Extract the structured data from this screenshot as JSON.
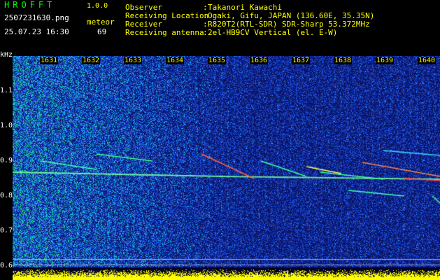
{
  "app": {
    "name": "HROFFT",
    "version": "1.0.0"
  },
  "capture": {
    "filename": "2507231630.png",
    "datetime": "25.07.23 16:30",
    "meteor_label": "meteor",
    "meteor_count": "69"
  },
  "info": [
    {
      "label": "Observer",
      "value": "Takanori Kawachi"
    },
    {
      "label": "Receiving Location",
      "value": "Ogaki, Gifu, JAPAN (136.60E, 35.35N)"
    },
    {
      "label": "Receiver",
      "value": "R820T2(RTL-SDR) SDR-Sharp 53.372MHz"
    },
    {
      "label": "Receiving antenna",
      "value": "2el-HB9CV Vertical (el. E-W)"
    }
  ],
  "spectrogram": {
    "y_unit": "kHz",
    "y_ticks": [
      "1.1",
      "1.0",
      "0.9",
      "0.8",
      "0.7",
      "0.6"
    ],
    "time_ticks": [
      "1631",
      "1632",
      "1633",
      "1634",
      "1635",
      "1636",
      "1637",
      "1638",
      "1639",
      "1640"
    ],
    "colors": {
      "background": "#0a1466",
      "noise": "#2050ff",
      "signal": "#ffff00",
      "level_bar": "#ffff00"
    }
  }
}
